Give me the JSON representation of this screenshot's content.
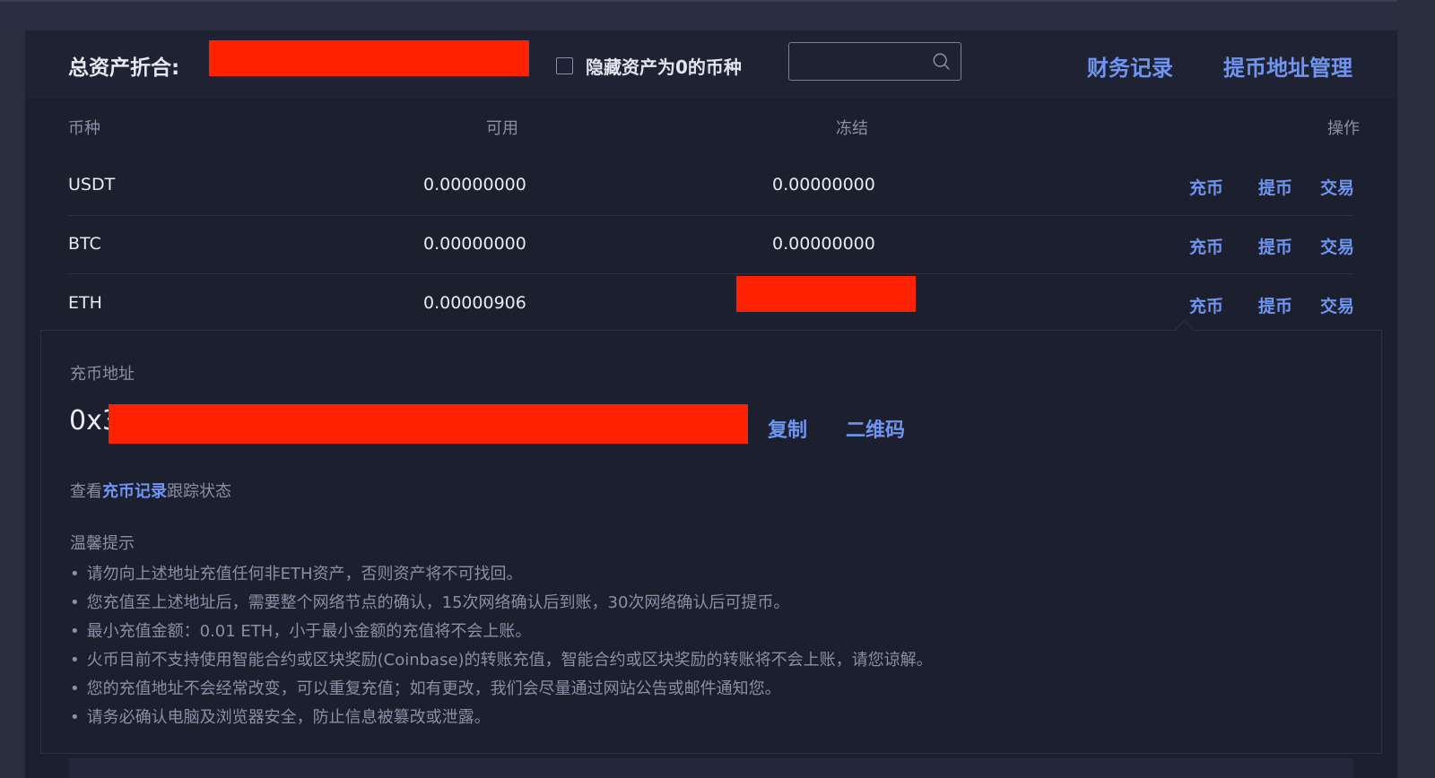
{
  "header": {
    "total_label": "总资产折合:",
    "hide_zero_label": "隐藏资产为0的币种",
    "search": {
      "value": "",
      "placeholder": ""
    },
    "links": [
      "财务记录",
      "提币地址管理"
    ]
  },
  "table": {
    "columns": [
      "币种",
      "可用",
      "冻结",
      "操作"
    ],
    "rows": [
      {
        "coin": "USDT",
        "available": "0.00000000",
        "frozen": "0.00000000"
      },
      {
        "coin": "BTC",
        "available": "0.00000000",
        "frozen": "0.00000000"
      },
      {
        "coin": "ETH",
        "available": "0.00000906",
        "frozen": ""
      }
    ],
    "actions": [
      "充币",
      "提币",
      "交易"
    ]
  },
  "deposit_panel": {
    "label": "充币地址",
    "address_prefix": "0x3",
    "copy_label": "复制",
    "qr_label": "二维码",
    "view_prefix": "查看",
    "view_link": "充币记录",
    "view_suffix": "跟踪状态",
    "tips_title": "温馨提示",
    "tips": [
      "请勿向上述地址充值任何非ETH资产，否则资产将不可找回。",
      "您充值至上述地址后，需要整个网络节点的确认，15次网络确认后到账，30次网络确认后可提币。",
      "最小充值金额：0.01 ETH，小于最小金额的充值将不会上账。",
      "火币目前不支持使用智能合约或区块奖励(Coinbase)的转账充值，智能合约或区块奖励的转账将不会上账，请您谅解。",
      "您的充值地址不会经常改变，可以重复充值；如有更改，我们会尽量通过网站公告或邮件通知您。",
      "请务必确认电脑及浏览器安全，防止信息被篡改或泄露。"
    ]
  },
  "colors": {
    "background": "#1c1f2e",
    "accent": "#6f95f0",
    "redaction": "#ff2200"
  }
}
